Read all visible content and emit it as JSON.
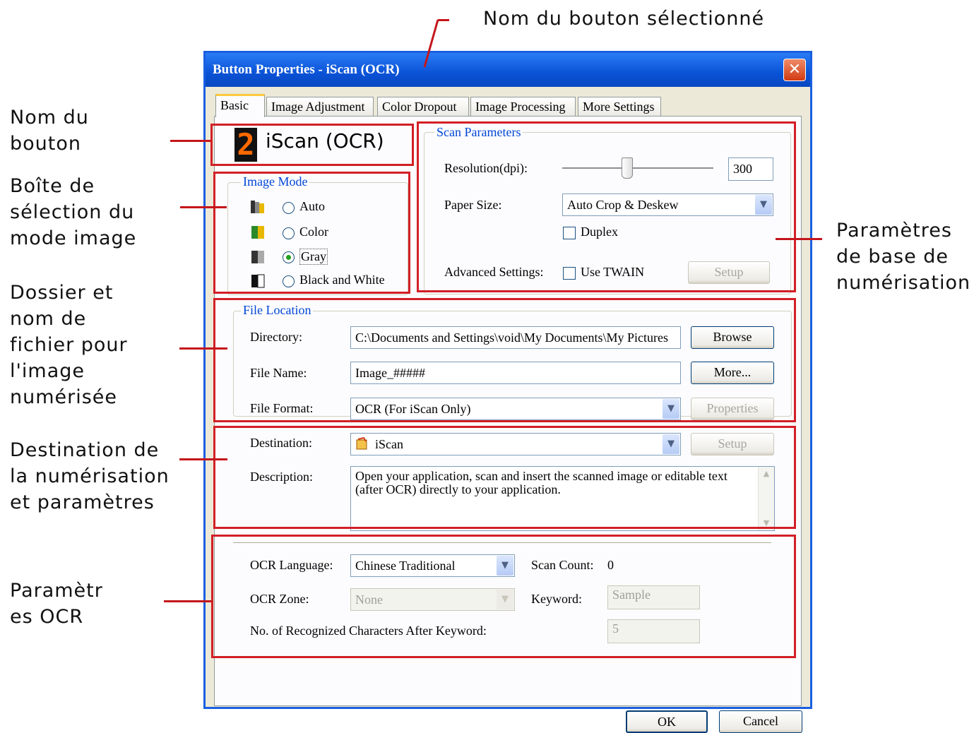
{
  "annotations": {
    "selected_button_name": "Nom du bouton sélectionné",
    "button_name": "Nom du\nbouton",
    "image_mode_box": "Boîte de\nsélection du\nmode image",
    "folder_filename": "Dossier et\nnom de\nfichier pour\nl'image\nnumérisée",
    "destination": "Destination de\nla numérisation\n et paramètres",
    "ocr_params": "Paramètr\nes OCR",
    "scan_params": "Paramètres\n de base de\nnumérisation"
  },
  "window": {
    "title": "Button Properties - iScan (OCR)",
    "close_glyph": "✕"
  },
  "tabs": [
    "Basic",
    "Image Adjustment",
    "Color Dropout",
    "Image Processing",
    "More Settings"
  ],
  "button_name": {
    "digit": "2",
    "label": "iScan (OCR)"
  },
  "image_mode": {
    "title": "Image Mode",
    "options": [
      "Auto",
      "Color",
      "Gray",
      "Black and White"
    ],
    "selected": "Gray"
  },
  "scan_parameters": {
    "title": "Scan Parameters",
    "resolution_label": "Resolution(dpi):",
    "resolution_value": "300",
    "paper_size_label": "Paper Size:",
    "paper_size_value": "Auto Crop & Deskew",
    "duplex_label": "Duplex",
    "advanced_label": "Advanced Settings:",
    "use_twain_label": "Use TWAIN",
    "setup_label": "Setup"
  },
  "file_location": {
    "title": "File Location",
    "directory_label": "Directory:",
    "directory_value": "C:\\Documents and Settings\\void\\My Documents\\My Pictures",
    "browse_label": "Browse",
    "file_name_label": "File Name:",
    "file_name_value": "Image_#####",
    "more_label": "More...",
    "file_format_label": "File Format:",
    "file_format_value": "OCR (For iScan Only)",
    "properties_label": "Properties"
  },
  "destination": {
    "destination_label": "Destination:",
    "destination_value": "iScan",
    "setup_label": "Setup",
    "description_label": "Description:",
    "description_value": "Open your application, scan and insert the scanned image or editable text (after OCR) directly to your application."
  },
  "ocr": {
    "language_label": "OCR Language:",
    "language_value": "Chinese Traditional",
    "scan_count_label": "Scan Count:",
    "scan_count_value": "0",
    "zone_label": "OCR Zone:",
    "zone_value": "None",
    "keyword_label": "Keyword:",
    "keyword_value": "Sample",
    "recognized_label": "No. of Recognized Characters After Keyword:",
    "recognized_value": "5"
  },
  "footer": {
    "ok_label": "OK",
    "cancel_label": "Cancel"
  },
  "colors": {
    "annotation_red": "#d21f26",
    "title_blue": "#0a52d6",
    "group_title_blue": "#0046d5"
  }
}
